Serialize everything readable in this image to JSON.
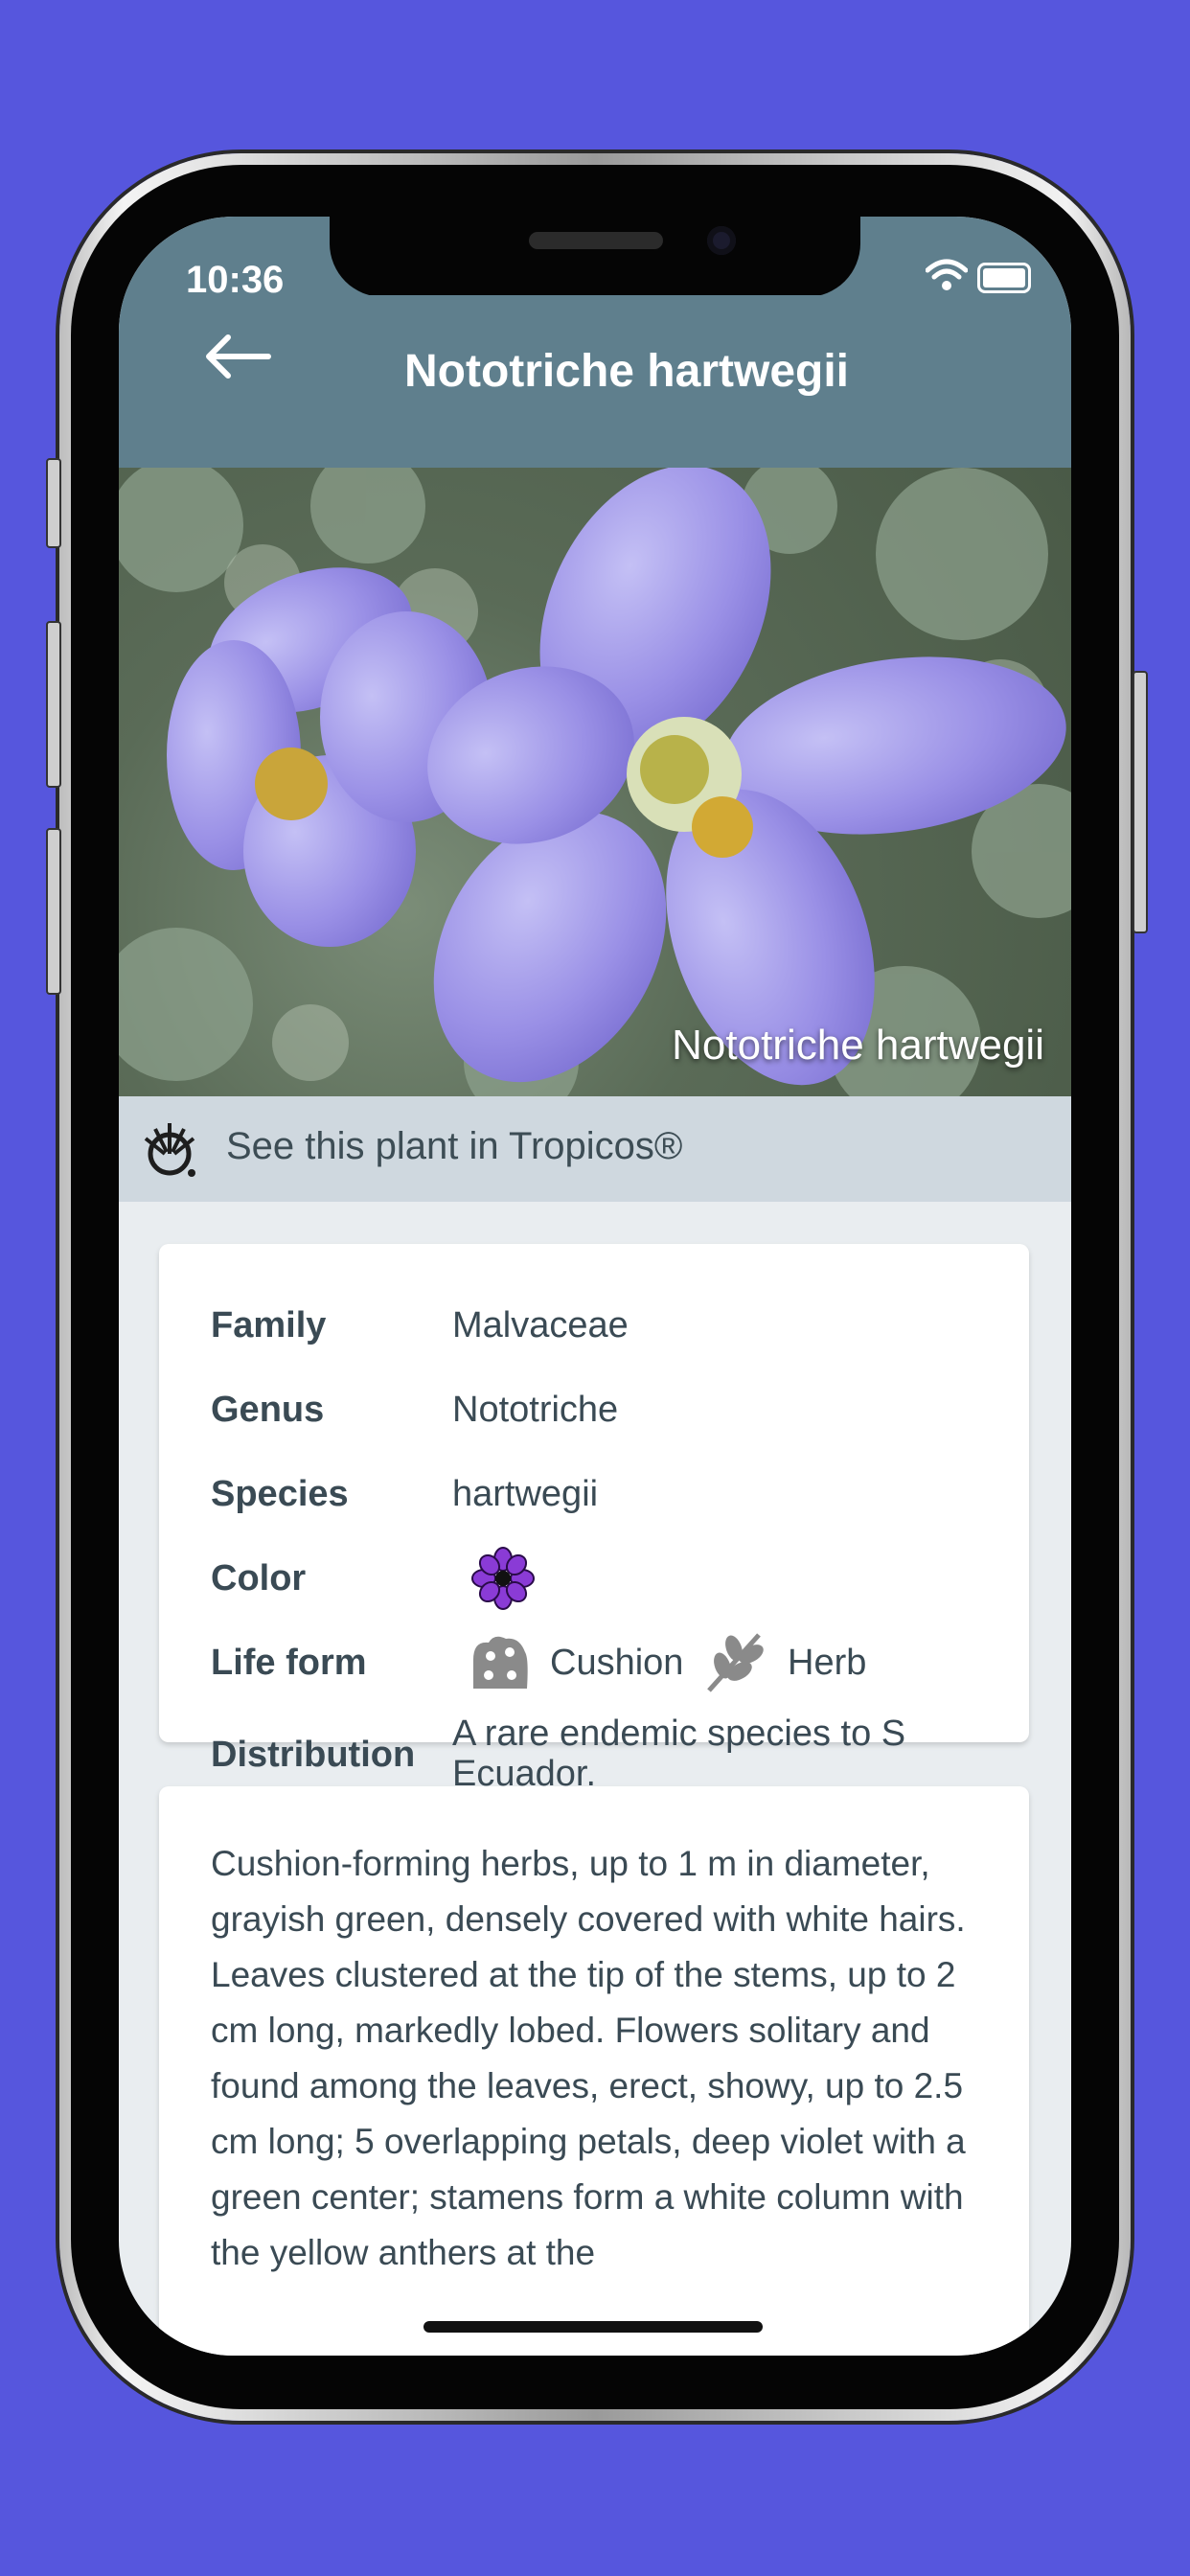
{
  "status_bar": {
    "time": "10:36",
    "signal": "....",
    "accent": "#5f7f8d"
  },
  "header": {
    "title": "Nototriche hartwegii",
    "back_icon": "arrow-left-icon"
  },
  "photo": {
    "caption": "Nototriche hartwegii"
  },
  "tropicos": {
    "label": "See this plant in Tropicos®",
    "icon": "tropicos-logo-icon"
  },
  "details": {
    "family_label": "Family",
    "family_value": "Malvaceae",
    "genus_label": "Genus",
    "genus_value": "Nototriche",
    "species_label": "Species",
    "species_value": "hartwegii",
    "color_label": "Color",
    "color_icon": "violet-flower-icon",
    "color_hex": "#8a3bd6",
    "lifeform_label": "Life form",
    "lifeforms": [
      {
        "label": "Cushion",
        "icon": "cushion-plant-icon"
      },
      {
        "label": "Herb",
        "icon": "herb-leaf-icon"
      }
    ],
    "distribution_label": "Distribution",
    "distribution_value": "A rare endemic species to S Ecuador."
  },
  "description": "Cushion-forming herbs, up to 1 m in diameter, grayish green, densely covered with white hairs. Leaves clustered at the tip of the stems, up to 2 cm long, markedly lobed. Flowers solitary and found among the leaves, erect, showy, up to 2.5 cm long; 5 overlapping petals, deep violet with a green center; stamens form a white column with the yellow anthers at the"
}
